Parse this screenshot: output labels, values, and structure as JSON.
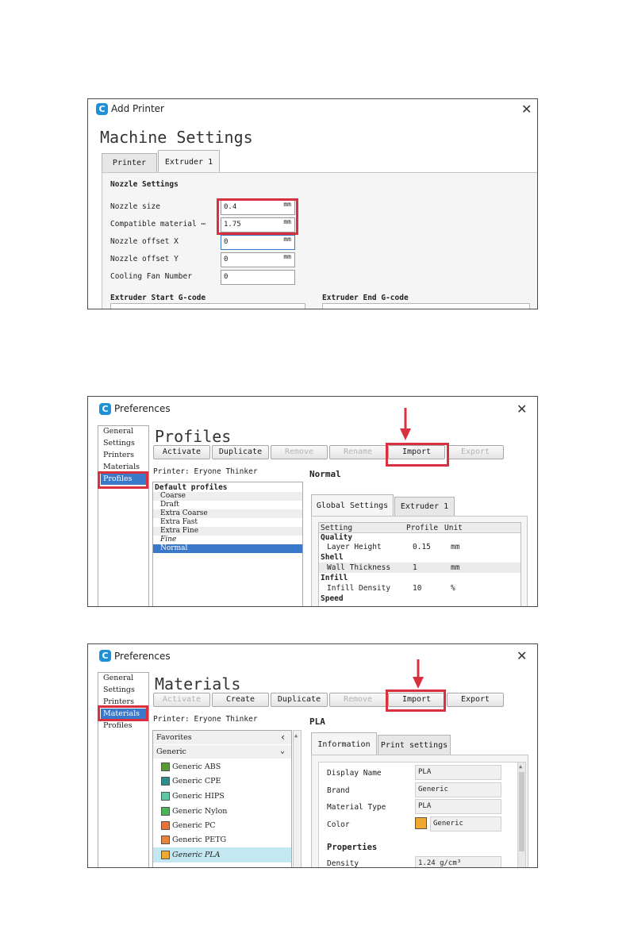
{
  "add_printer": {
    "window_title": "Add Printer",
    "heading": "Machine Settings",
    "tabs": [
      "Printer",
      "Extruder 1"
    ],
    "section_title": "Nozzle Settings",
    "fields": [
      {
        "label": "Nozzle size",
        "value": "0.4",
        "unit": "mm"
      },
      {
        "label": "Compatible material ⋯",
        "value": "1.75",
        "unit": "mm"
      },
      {
        "label": "Nozzle offset X",
        "value": "0",
        "unit": "mm"
      },
      {
        "label": "Nozzle offset Y",
        "value": "0",
        "unit": "mm"
      },
      {
        "label": "Cooling Fan Number",
        "value": "0",
        "unit": ""
      }
    ],
    "start_gcode_label": "Extruder Start G-code",
    "end_gcode_label": "Extruder End G-code"
  },
  "profiles_win": {
    "window_title": "Preferences",
    "nav": [
      "General",
      "Settings",
      "Printers",
      "Materials",
      "Profiles"
    ],
    "nav_selected": "Profiles",
    "heading": "Profiles",
    "buttons": [
      {
        "label": "Activate",
        "enabled": true
      },
      {
        "label": "Duplicate",
        "enabled": true
      },
      {
        "label": "Remove",
        "enabled": false
      },
      {
        "label": "Rename",
        "enabled": false
      },
      {
        "label": "Import",
        "enabled": true
      },
      {
        "label": "Export",
        "enabled": false
      }
    ],
    "printer_line": "Printer: Eryone Thinker",
    "profile_group": "Default profiles",
    "profiles": [
      "Coarse",
      "Draft",
      "Extra Coarse",
      "Extra Fast",
      "Extra Fine",
      "Fine",
      "Normal"
    ],
    "selected_profile": "Normal",
    "detail_title": "Normal",
    "detail_tabs": [
      "Global Settings",
      "Extruder 1"
    ],
    "table_headers": [
      "Setting",
      "Profile",
      "Unit"
    ],
    "table_rows": [
      {
        "type": "group",
        "label": "Quality"
      },
      {
        "type": "row",
        "label": "Layer Height",
        "value": "0.15",
        "unit": "mm"
      },
      {
        "type": "group",
        "label": "Shell"
      },
      {
        "type": "row",
        "label": "Wall Thickness",
        "value": "1",
        "unit": "mm"
      },
      {
        "type": "group",
        "label": "Infill"
      },
      {
        "type": "row",
        "label": "Infill Density",
        "value": "10",
        "unit": "%"
      },
      {
        "type": "group",
        "label": "Speed"
      }
    ]
  },
  "materials_win": {
    "window_title": "Preferences",
    "nav": [
      "General",
      "Settings",
      "Printers",
      "Materials",
      "Profiles"
    ],
    "nav_selected": "Materials",
    "heading": "Materials",
    "buttons": [
      {
        "label": "Activate",
        "enabled": false
      },
      {
        "label": "Create",
        "enabled": true
      },
      {
        "label": "Duplicate",
        "enabled": true
      },
      {
        "label": "Remove",
        "enabled": false
      },
      {
        "label": "Import",
        "enabled": true
      },
      {
        "label": "Export",
        "enabled": true
      }
    ],
    "printer_line": "Printer: Eryone Thinker",
    "favorites_label": "Favorites",
    "generic_label": "Generic",
    "materials": [
      {
        "name": "Generic ABS",
        "color": "#5a9a32"
      },
      {
        "name": "Generic CPE",
        "color": "#2f8a8a"
      },
      {
        "name": "Generic HIPS",
        "color": "#5cc8a8"
      },
      {
        "name": "Generic Nylon",
        "color": "#4cb35a"
      },
      {
        "name": "Generic PC",
        "color": "#e8733a"
      },
      {
        "name": "Generic PETG",
        "color": "#e8833a"
      },
      {
        "name": "Generic PLA",
        "color": "#f0a830"
      }
    ],
    "selected_material": "Generic PLA",
    "detail_title": "PLA",
    "detail_tabs": [
      "Information",
      "Print settings"
    ],
    "info": [
      {
        "label": "Display Name",
        "value": "PLA"
      },
      {
        "label": "Brand",
        "value": "Generic"
      },
      {
        "label": "Material Type",
        "value": "PLA"
      },
      {
        "label": "Color",
        "value": "Generic",
        "swatch": "#f0a830"
      }
    ],
    "properties_label": "Properties",
    "density_label": "Density",
    "density_value": "1.24 g/cm³"
  },
  "colors": {
    "highlight": "#d9303f",
    "selection": "#3a78c9",
    "material_selection": "#c3e8f2",
    "logo": "#1f8fd6"
  }
}
